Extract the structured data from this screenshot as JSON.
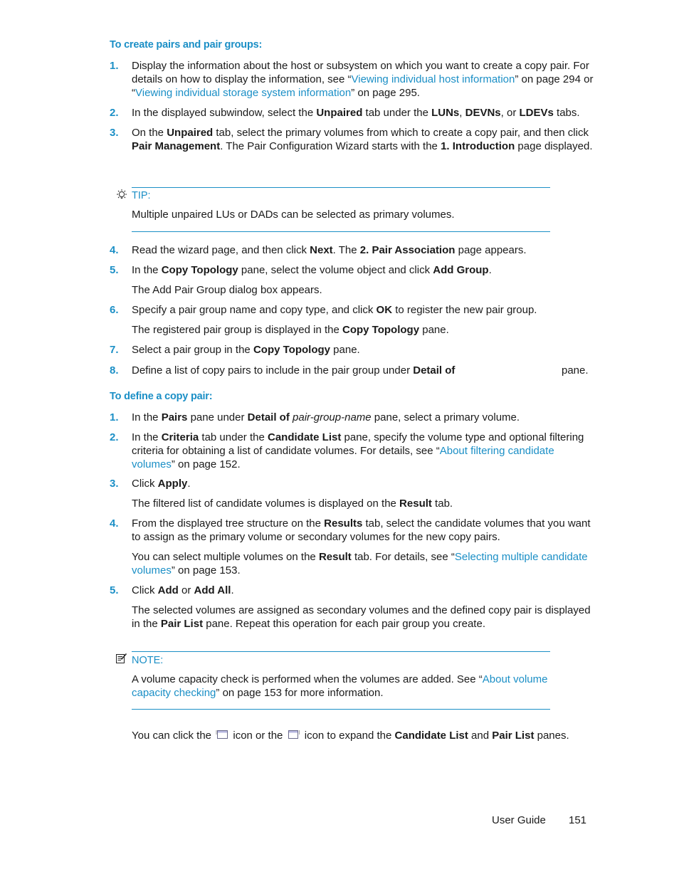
{
  "section1": {
    "heading": "To create pairs and pair groups:",
    "steps": [
      {
        "num": "1.",
        "parts": [
          {
            "t": "Display the information about the host or subsystem on which you want to create a copy pair. For details on how to display the information, see “"
          },
          {
            "t": "Viewing individual host information",
            "link": true
          },
          {
            "t": "” on page 294 or “"
          },
          {
            "t": "Viewing individual storage system information",
            "link": true
          },
          {
            "t": "” on page 295."
          }
        ]
      },
      {
        "num": "2.",
        "parts": [
          {
            "t": "In the displayed subwindow, select the "
          },
          {
            "t": "Unpaired",
            "b": true
          },
          {
            "t": " tab under the "
          },
          {
            "t": "LUNs",
            "b": true
          },
          {
            "t": ", "
          },
          {
            "t": "DEVNs",
            "b": true
          },
          {
            "t": ", or "
          },
          {
            "t": "LDEVs",
            "b": true
          },
          {
            "t": " tabs."
          }
        ]
      },
      {
        "num": "3.",
        "parts": [
          {
            "t": "On the "
          },
          {
            "t": "Unpaired",
            "b": true
          },
          {
            "t": " tab, select the primary volumes from which to create a copy pair, and then click "
          },
          {
            "t": "Pair Management",
            "b": true
          },
          {
            "t": ". The Pair Configuration Wizard starts with the "
          },
          {
            "t": "1. Introduction",
            "b": true
          },
          {
            "t": " page displayed."
          }
        ]
      }
    ],
    "tip": {
      "label": "TIP:",
      "icon": "lightbulb-icon",
      "text": "Multiple unpaired LUs or DADs can be selected as primary volumes."
    },
    "steps2": [
      {
        "num": "4.",
        "parts": [
          {
            "t": "Read the wizard page, and then click "
          },
          {
            "t": "Next",
            "b": true
          },
          {
            "t": ". The "
          },
          {
            "t": "2. Pair Association",
            "b": true
          },
          {
            "t": " page appears."
          }
        ]
      },
      {
        "num": "5.",
        "parts": [
          {
            "t": "In the "
          },
          {
            "t": "Copy Topology",
            "b": true
          },
          {
            "t": " pane, select the volume object and click "
          },
          {
            "t": "Add Group",
            "b": true
          },
          {
            "t": "."
          }
        ],
        "sub": [
          {
            "t": "The Add Pair Group dialog box appears."
          }
        ]
      },
      {
        "num": "6.",
        "parts": [
          {
            "t": "Specify a pair group name and copy type, and click "
          },
          {
            "t": "OK",
            "b": true
          },
          {
            "t": " to register the new pair group."
          }
        ],
        "sub": [
          {
            "t": "The registered pair group is displayed in the "
          },
          {
            "t": "Copy Topology",
            "b": true
          },
          {
            "t": " pane."
          }
        ]
      },
      {
        "num": "7.",
        "parts": [
          {
            "t": "Select a pair group in the "
          },
          {
            "t": "Copy Topology",
            "b": true
          },
          {
            "t": " pane."
          }
        ]
      },
      {
        "num": "8.",
        "parts": [
          {
            "t": "Define a list of copy pairs to include in the pair group under "
          },
          {
            "t": "Detail of",
            "b": true
          }
        ],
        "tail": "pane."
      }
    ]
  },
  "section2": {
    "heading": "To define a copy pair:",
    "steps": [
      {
        "num": "1.",
        "parts": [
          {
            "t": "In the "
          },
          {
            "t": "Pairs",
            "b": true
          },
          {
            "t": " pane under "
          },
          {
            "t": "Detail of",
            "b": true
          },
          {
            "t": " "
          },
          {
            "t": "pair-group-name",
            "i": true
          },
          {
            "t": " pane, select a primary volume."
          }
        ]
      },
      {
        "num": "2.",
        "parts": [
          {
            "t": "In the "
          },
          {
            "t": "Criteria",
            "b": true
          },
          {
            "t": " tab under the "
          },
          {
            "t": "Candidate List",
            "b": true
          },
          {
            "t": " pane, specify the volume type and optional filtering criteria for obtaining a list of candidate volumes. For details, see “"
          },
          {
            "t": "About filtering candidate volumes",
            "link": true
          },
          {
            "t": "” on page 152."
          }
        ]
      },
      {
        "num": "3.",
        "parts": [
          {
            "t": "Click "
          },
          {
            "t": "Apply",
            "b": true
          },
          {
            "t": "."
          }
        ],
        "sub": [
          {
            "t": "The filtered list of candidate volumes is displayed on the "
          },
          {
            "t": "Result",
            "b": true
          },
          {
            "t": " tab."
          }
        ]
      },
      {
        "num": "4.",
        "parts": [
          {
            "t": "From the displayed tree structure on the "
          },
          {
            "t": "Results",
            "b": true
          },
          {
            "t": " tab, select the candidate volumes that you want to assign as the primary volume or secondary volumes for the new copy pairs."
          }
        ],
        "sub": [
          {
            "t": "You can select multiple volumes on the "
          },
          {
            "t": "Result",
            "b": true
          },
          {
            "t": " tab. For details, see “"
          },
          {
            "t": "Selecting multiple candidate volumes",
            "link": true
          },
          {
            "t": "” on page 153."
          }
        ]
      },
      {
        "num": "5.",
        "parts": [
          {
            "t": "Click "
          },
          {
            "t": "Add",
            "b": true
          },
          {
            "t": " or "
          },
          {
            "t": "Add All",
            "b": true
          },
          {
            "t": "."
          }
        ],
        "sub": [
          {
            "t": "The selected volumes are assigned as secondary volumes and the defined copy pair is displayed in the "
          },
          {
            "t": "Pair List",
            "b": true
          },
          {
            "t": " pane. Repeat this operation for each pair group you create."
          }
        ]
      }
    ],
    "note": {
      "label": "NOTE:",
      "icon": "note-pad-icon",
      "parts": [
        {
          "t": "A volume capacity check is performed when the volumes are added. See “"
        },
        {
          "t": "About volume capacity checking",
          "link": true
        },
        {
          "t": "” on page 153 for more information."
        }
      ]
    },
    "final": {
      "before_icon1": "You can click the ",
      "icon1": "expand-candidate-list-icon",
      "between": " icon or the ",
      "icon2": "expand-pair-list-icon",
      "after_icon2": " icon to expand the ",
      "bold1": "Candidate List",
      "and": " and ",
      "bold2": "Pair List",
      "end": " panes."
    }
  },
  "footer": {
    "title": "User Guide",
    "page": "151"
  },
  "colors": {
    "accent": "#1b8fc6",
    "text": "#1a1a1a"
  }
}
